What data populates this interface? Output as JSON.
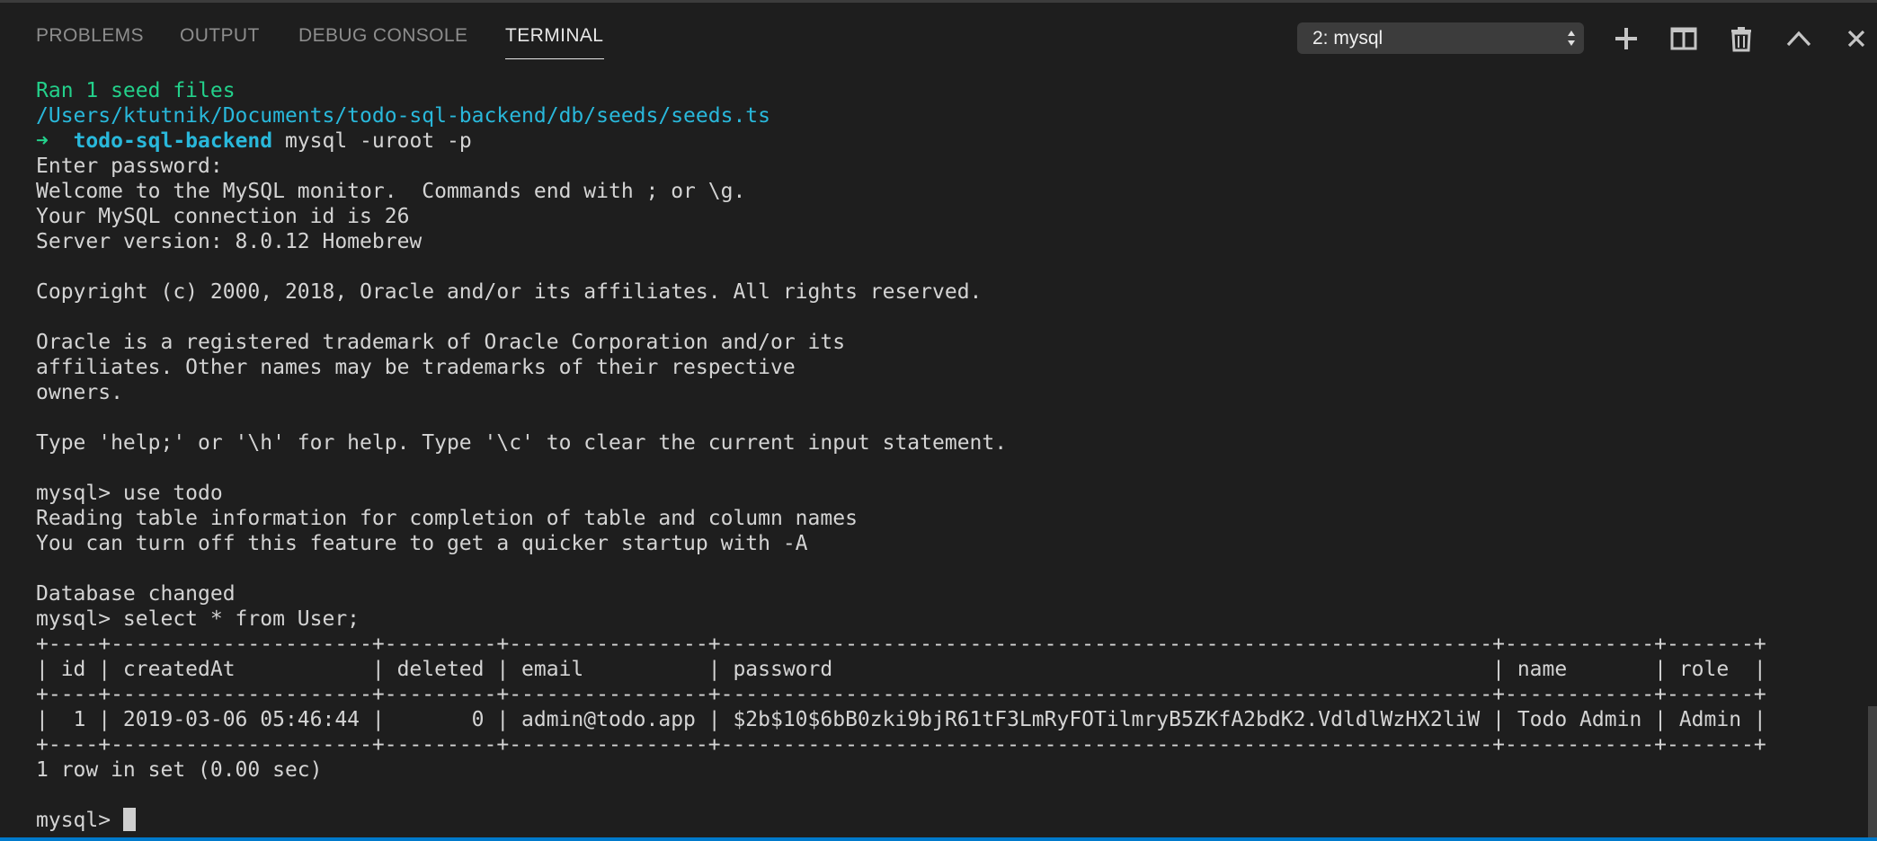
{
  "panel": {
    "tabs": [
      {
        "label": "PROBLEMS"
      },
      {
        "label": "OUTPUT"
      },
      {
        "label": "DEBUG CONSOLE"
      },
      {
        "label": "TERMINAL",
        "active": true
      }
    ],
    "terminal_select": {
      "selected": "2: mysql"
    },
    "actions": [
      "plus-icon",
      "split-icon",
      "trash-icon",
      "chevron-up-icon",
      "close-icon"
    ]
  },
  "colors": {
    "background": "#1e1e1e",
    "text": "#d4d4d4",
    "green": "#23d18b",
    "cyan": "#29b8db",
    "accent_bar": "#007acc"
  },
  "terminal": {
    "lines": [
      {
        "text": "Ran 1 seed files"
      },
      {
        "text": "/Users/ktutnik/Documents/todo-sql-backend/db/seeds/seeds.ts"
      },
      {
        "prompt_arrow": "➜",
        "prompt_dir": "todo-sql-backend",
        "command": " mysql -uroot -p"
      },
      {
        "text": "Enter password:"
      },
      {
        "text": "Welcome to the MySQL monitor.  Commands end with ; or \\g."
      },
      {
        "text": "Your MySQL connection id is 26"
      },
      {
        "text": "Server version: 8.0.12 Homebrew"
      },
      {
        "text": ""
      },
      {
        "text": "Copyright (c) 2000, 2018, Oracle and/or its affiliates. All rights reserved."
      },
      {
        "text": ""
      },
      {
        "text": "Oracle is a registered trademark of Oracle Corporation and/or its"
      },
      {
        "text": "affiliates. Other names may be trademarks of their respective"
      },
      {
        "text": "owners."
      },
      {
        "text": ""
      },
      {
        "text": "Type 'help;' or '\\h' for help. Type '\\c' to clear the current input statement."
      },
      {
        "text": ""
      },
      {
        "text": "mysql> use todo"
      },
      {
        "text": "Reading table information for completion of table and column names"
      },
      {
        "text": "You can turn off this feature to get a quicker startup with -A"
      },
      {
        "text": ""
      },
      {
        "text": "Database changed"
      },
      {
        "text": "mysql> select * from User;"
      },
      {
        "text": "+----+---------------------+---------+----------------+--------------------------------------------------------------+------------+-------+"
      },
      {
        "text": "| id | createdAt           | deleted | email          | password                                                     | name       | role  |"
      },
      {
        "text": "+----+---------------------+---------+----------------+--------------------------------------------------------------+------------+-------+"
      },
      {
        "text": "|  1 | 2019-03-06 05:46:44 |       0 | admin@todo.app | $2b$10$6bB0zki9bjR61tF3LmRyFOTilmryB5ZKfA2bdK2.VdldlWzHX2liW | Todo Admin | Admin |"
      },
      {
        "text": "+----+---------------------+---------+----------------+--------------------------------------------------------------+------------+-------+"
      },
      {
        "text": "1 row in set (0.00 sec)"
      },
      {
        "text": ""
      },
      {
        "text": "mysql> "
      }
    ]
  }
}
